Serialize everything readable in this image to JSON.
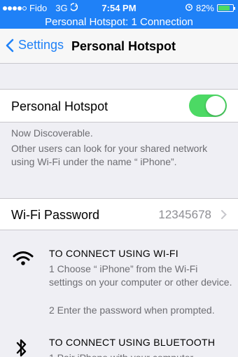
{
  "status_bar": {
    "carrier": "Fido",
    "network": "3G",
    "time": "7:54 PM",
    "battery_percent": "82%",
    "battery_level": 0.82,
    "signal_bars_filled": 4,
    "signal_bars_total": 5
  },
  "hotspot_banner": "Personal Hotspot: 1 Connection",
  "nav": {
    "back_label": "Settings",
    "title": "Personal Hotspot"
  },
  "hotspot_cell": {
    "label": "Personal Hotspot",
    "toggle_on": true
  },
  "discover_footer": {
    "line1": "Now Discoverable.",
    "line2": "Other users can look for your shared network using Wi-Fi under the name “ iPhone”."
  },
  "password_cell": {
    "label": "Wi-Fi Password",
    "value": "12345678"
  },
  "wifi_section": {
    "heading": "TO CONNECT USING WI-FI",
    "step1": "1 Choose “ iPhone” from the Wi-Fi settings on your computer or other device.",
    "step2": "2 Enter the password when prompted."
  },
  "bt_section": {
    "heading": "TO CONNECT USING BLUETOOTH",
    "step1": "1 Pair iPhone with your computer."
  },
  "colors": {
    "accent": "#1f81f7",
    "toggle_on": "#4cd964",
    "background": "#efeff4"
  }
}
